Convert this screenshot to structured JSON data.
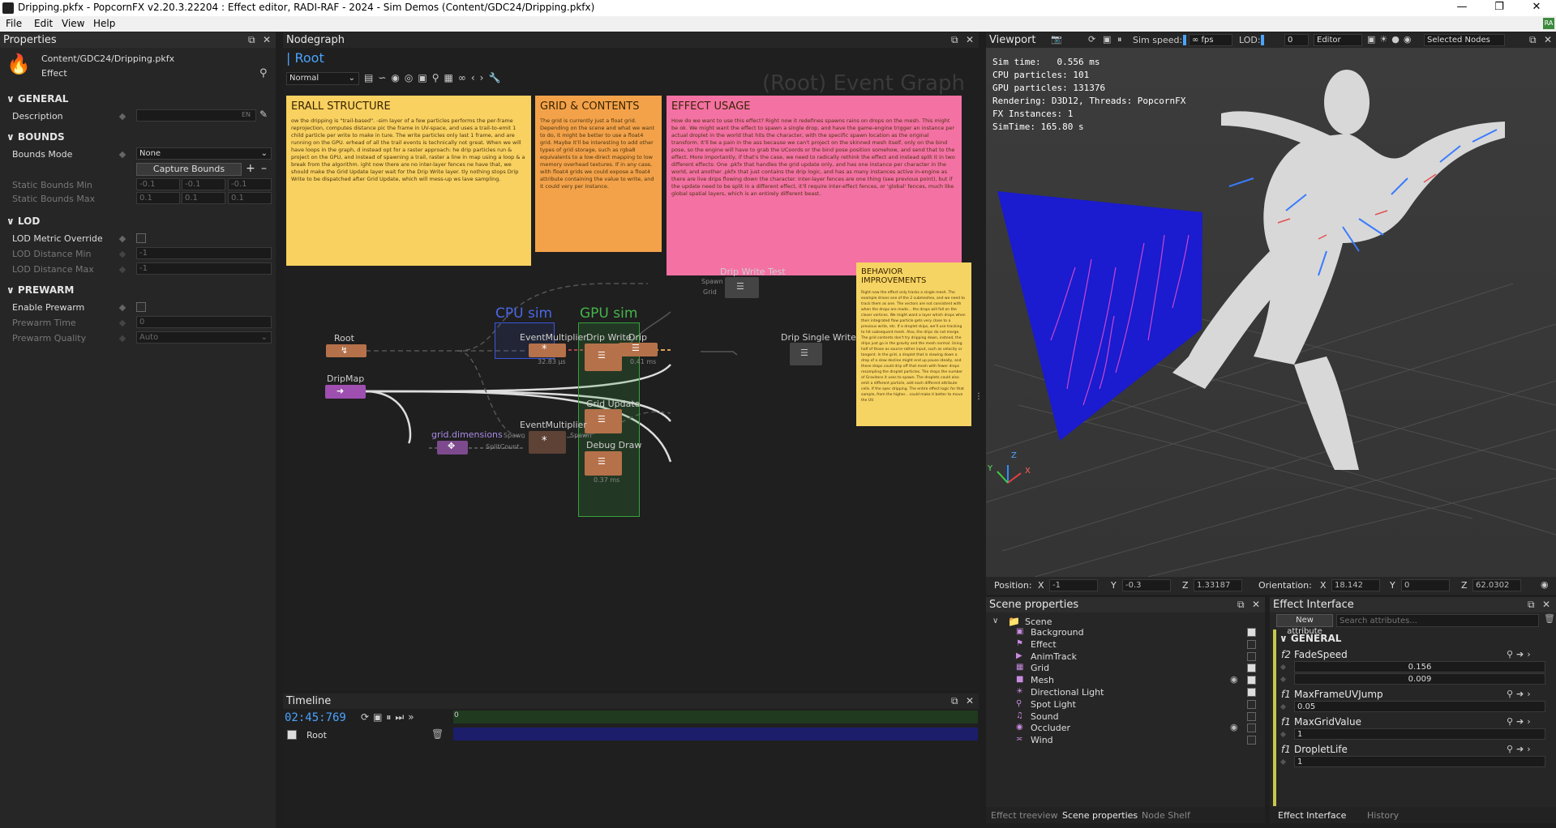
{
  "window": {
    "title": "Dripping.pkfx - PopcornFX v2.20.3.22204 : Effect editor, RADI-RAF - 2024 - Sim Demos (Content/GDC24/Dripping.pkfx)"
  },
  "menu": [
    "File",
    "Edit",
    "View",
    "Help"
  ],
  "properties": {
    "title": "Properties",
    "path": "Content/GDC24/Dripping.pkfx",
    "type": "Effect",
    "sections": {
      "general": "GENERAL",
      "bounds": "BOUNDS",
      "lod": "LOD",
      "prewarm": "PREWARM"
    },
    "labels": {
      "description": "Description",
      "bounds_mode": "Bounds Mode",
      "static_min": "Static Bounds Min",
      "static_max": "Static Bounds Max",
      "lod_override": "LOD Metric Override",
      "lod_min": "LOD Distance Min",
      "lod_max": "LOD Distance Max",
      "enable_prewarm": "Enable Prewarm",
      "prewarm_time": "Prewarm Time",
      "prewarm_quality": "Prewarm Quality"
    },
    "values": {
      "bounds_mode": "None",
      "capture": "Capture Bounds",
      "min": [
        "-0.1",
        "-0.1",
        "-0.1"
      ],
      "max": [
        "0.1",
        "0.1",
        "0.1"
      ],
      "lod_min": "-1",
      "lod_max": "-1",
      "prewarm_time": "0",
      "prewarm_quality": "Auto",
      "lang": "EN"
    }
  },
  "nodegraph": {
    "title": "Nodegraph",
    "breadcrumb": "Root",
    "mode": "Normal",
    "watermark": "(Root) Event Graph",
    "notes": {
      "overall": {
        "title": "ERALL STRUCTURE",
        "body": "ow the dripping is \"trail-based\". -sim layer of a few particles performs the per-frame reprojection, computes distance pic the frame in UV-space, and uses a trail-to-emit 1 child particle per write to make in ture. The write particles only last 1 frame, and are running on the GPU. erhead of all the trail events is technically not great. When we will have loops in the graph, d instead opt for a raster approach: he drip particles run & project on the GPU, and instead of spawning a trail, raster a line in map using a loop & a break from the algorithm. ight now there are no inter-layer fences ne have that, we should make the Grid Update layer wait for the Drip Write layer. tly nothing stops Drip Write to be dispatched after Grid Update, which will mess-up ws lave sampling."
      },
      "grid": {
        "title": "GRID & CONTENTS",
        "body": "The grid is currently just a float grid. Depending on the scene and what we want to do, it might be better to use a float4 grid. Maybe it'll be interesting to add other types of grid storage, such as rgba8 equivalents to a low-direct mapping to low memory overhead textures. If in any case, with float4 grids we could expose a float4 attribute containing the value to write, and it could very per instance."
      },
      "usage": {
        "title": "EFFECT USAGE",
        "body": "How do we want to use this effect? Right now it redefines spawns rains on drops on the mesh. This might be ok. We might want the effect to spawn a single drop, and have the game-engine trigger an instance per actual droplet in the world that hits the character, with the specific spawn location as the original transform. It'll be a pain in the ass because we can't project on the skinned mesh itself, only on the bind pose, so the engine will have to grab the UCoords or the bind pose position somehow, and send that to the effect. More importantly, if that's the case, we need to radically rethink the effect and instead split it in two different effects: One .pkfx that handles the grid update only, and has one instance per character in the world, and another .pkfx that just contains the drip logic, and has as many instances active in-engine as there are live drips flowing down the character. Inter-layer fences are one thing (see previous point), but if the update need to be split in a different effect, it'll require inter-effect fences, or 'global' fences, much like global spatial layers, which is an entirely different beast."
      },
      "behavior": {
        "title": "BEHAVIOR IMPROVEMENTS",
        "body": "Right now the effect only tracks a single mesh. The example drives one of the 2 submeshes, and we need to track them as one. The vectors are not consistent with when the drops are made... the drops will fall on the closer vertices. We might want a layer which drops when their integrated flow particle gets very close to a previous write, etc. If a droplet skips, we'll use tracking to hit subsequent mesh. Also, the drips do not merge. The grid contents don't try dripping down, instead, the drips just go in the gravity and the mesh normal. Using half of those as source-rather input, such as velocity or tangent. In the grid, a droplet that is slowing down a drop of a slow decline might end up pause ideally, and these drops could drip off that mesh with fewer drops resampling the droplet particles. The drops the number of Gravitons it uses to spawn. The droplets could also emit a different particle, add each different attribute cells. If the spec dripping. The entire effect logic for that sample, from the higher... could make it better to move the UV."
      }
    },
    "nodes": {
      "root": "Root",
      "dripmap": "DripMap",
      "evm1": "EventMultiplier",
      "evm1_sub": "32.83 µs",
      "drip": "Drip",
      "drip_sub": "0.41 ms",
      "evm2": "EventMultiplier",
      "griddim": "grid.dimensions",
      "dripwritetest": "Drip Write Test",
      "dripwrite": "Drip Write",
      "dripsingle": "Drip Single Write",
      "gridupdate": "Grid Update",
      "debugdraw": "Debug Draw",
      "debugdraw_sub": "0.37 ms",
      "cpu": "CPU sim",
      "gpu": "GPU sim",
      "spawn": "Spawn",
      "grid": "Grid",
      "splitcount": "SplitCount"
    }
  },
  "timeline": {
    "title": "Timeline",
    "time": "02:45:769",
    "track": "Root",
    "zero": "0"
  },
  "viewport": {
    "title": "Viewport",
    "simspeed_label": "Sim speed:",
    "fps": "∞ fps",
    "lod_label": "LOD:",
    "lod_val": "0",
    "mode": "Editor",
    "selected": "Selected Nodes",
    "stats": [
      "Sim time:   0.556 ms",
      "CPU particles: 101",
      "GPU particles: 131376",
      "Rendering: D3D12, Threads: PopcornFX",
      "FX Instances: 1",
      "SimTime: 165.80 s"
    ],
    "position_label": "Position:",
    "orientation_label": "Orientation:",
    "pos": {
      "x": "-1",
      "y": "-0.3",
      "z": "1.33187"
    },
    "ori": {
      "x": "18.142",
      "y": "0",
      "z": "62.0302"
    },
    "axes": {
      "x": "X",
      "y": "Y",
      "z": "Z"
    }
  },
  "scene": {
    "title": "Scene properties",
    "root": "Scene",
    "items": [
      {
        "label": "Background",
        "checked": true,
        "eye": false
      },
      {
        "label": "Effect",
        "checked": false,
        "eye": false
      },
      {
        "label": "AnimTrack",
        "checked": false,
        "eye": false
      },
      {
        "label": "Grid",
        "checked": true,
        "eye": false
      },
      {
        "label": "Mesh",
        "checked": true,
        "eye": true
      },
      {
        "label": "Directional Light",
        "checked": true,
        "eye": false
      },
      {
        "label": "Spot Light",
        "checked": false,
        "eye": false
      },
      {
        "label": "Sound",
        "checked": false,
        "eye": false
      },
      {
        "label": "Occluder",
        "checked": false,
        "eye": true
      },
      {
        "label": "Wind",
        "checked": false,
        "eye": false
      }
    ],
    "tabs": [
      "Effect treeview",
      "Scene properties",
      "Node Shelf"
    ]
  },
  "effect_interface": {
    "title": "Effect Interface",
    "new_attr": "New attribute",
    "search_placeholder": "Search attributes...",
    "section": "GENERAL",
    "attrs": [
      {
        "prefix": "f2",
        "name": "FadeSpeed",
        "vals": [
          "0.156",
          "0.009"
        ]
      },
      {
        "prefix": "f1",
        "name": "MaxFrameUVJump",
        "vals": [
          "0.05"
        ]
      },
      {
        "prefix": "f1",
        "name": "MaxGridValue",
        "vals": [
          "1"
        ]
      },
      {
        "prefix": "f1",
        "name": "DropletLife",
        "vals": [
          "1"
        ]
      }
    ],
    "tabs": [
      "Effect Interface",
      "History"
    ]
  },
  "colors": {
    "accent": "#4aa3ff",
    "cpu_box": "#3b56d9",
    "gpu_box": "#35a23a",
    "node_orange": "#b5714a",
    "node_purple": "#9e4fb0"
  }
}
